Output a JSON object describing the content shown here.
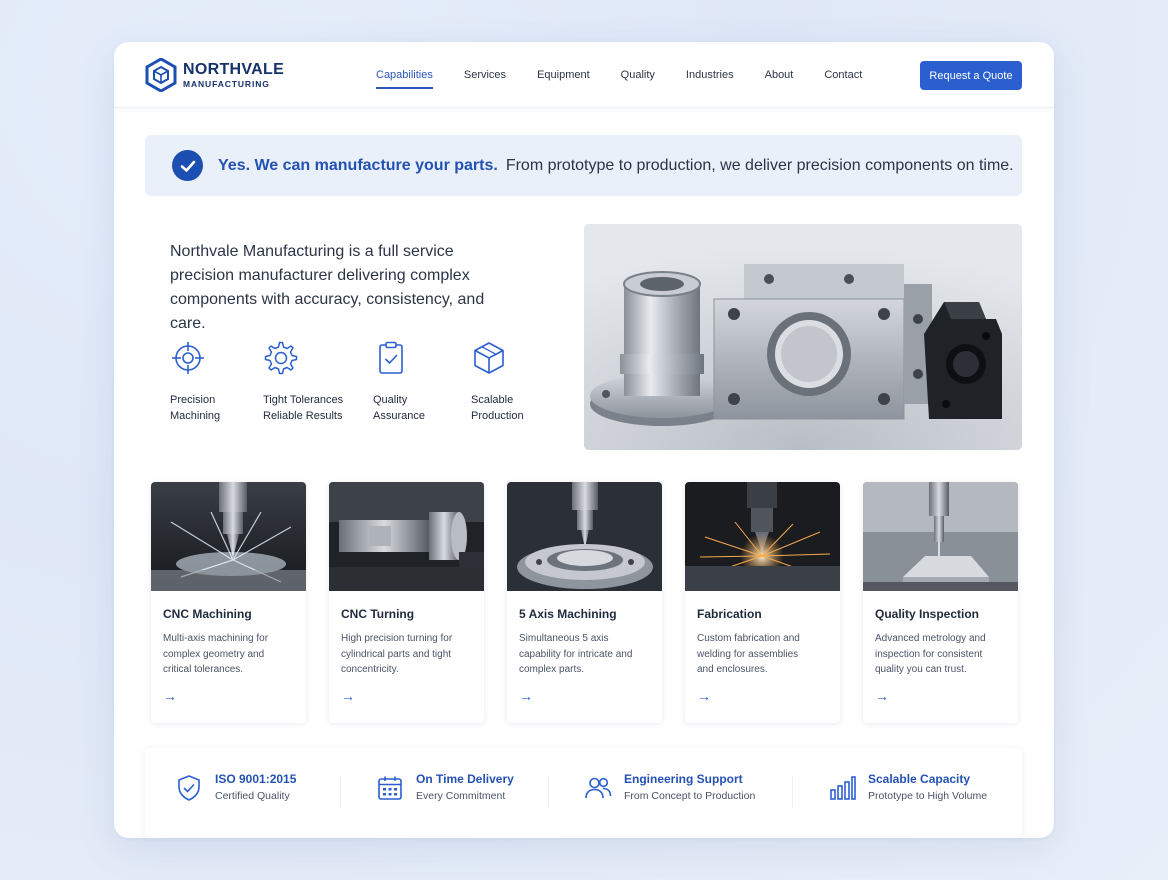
{
  "brand": {
    "name": "NORTHVALE",
    "sub": "MANUFACTURING"
  },
  "nav": {
    "items": [
      {
        "label": "Capabilities",
        "active": true
      },
      {
        "label": "Services"
      },
      {
        "label": "Equipment"
      },
      {
        "label": "Quality"
      },
      {
        "label": "Industries"
      },
      {
        "label": "About"
      },
      {
        "label": "Contact"
      }
    ],
    "cta": "Request a Quote"
  },
  "banner": {
    "strong": "Yes. We can manufacture your parts.",
    "text": "From prototype to production, we deliver precision components on time.",
    "icon": "check-circle-icon"
  },
  "intro": "Northvale Manufacturing is a full service precision manufacturer delivering complex components with accuracy, consistency, and care.",
  "features": [
    {
      "label": "Precision\nMachining",
      "icon": "crosshair-icon"
    },
    {
      "label": "Tight Tolerances\nReliable Results",
      "icon": "gear-icon"
    },
    {
      "label": "Quality\nAssurance",
      "icon": "clipboard-check-icon"
    },
    {
      "label": "Scalable\nProduction",
      "icon": "cube-icon"
    }
  ],
  "services": [
    {
      "title": "CNC Machining",
      "desc": "Multi-axis machining for complex geometry and critical tolerances.",
      "arrow": "→"
    },
    {
      "title": "CNC Turning",
      "desc": "High precision turning for cylindrical parts and tight concentricity.",
      "arrow": "→"
    },
    {
      "title": "5 Axis Machining",
      "desc": "Simultaneous 5 axis capability for intricate and complex parts.",
      "arrow": "→"
    },
    {
      "title": "Fabrication",
      "desc": "Custom fabrication and welding for assemblies and enclosures.",
      "arrow": "→"
    },
    {
      "title": "Quality Inspection",
      "desc": "Advanced metrology and inspection for consistent quality you can trust.",
      "arrow": "→"
    }
  ],
  "stats": [
    {
      "title": "ISO 9001:2015",
      "sub": "Certified Quality",
      "icon": "shield-check-icon"
    },
    {
      "title": "On Time Delivery",
      "sub": "Every Commitment",
      "icon": "calendar-icon"
    },
    {
      "title": "Engineering Support",
      "sub": "From Concept to Production",
      "icon": "users-icon"
    },
    {
      "title": "Scalable Capacity",
      "sub": "Prototype to High Volume",
      "icon": "bar-chart-icon"
    }
  ],
  "colors": {
    "primary": "#2b5fd0",
    "navy": "#16326b",
    "banner_bg": "#eaf0fa"
  }
}
